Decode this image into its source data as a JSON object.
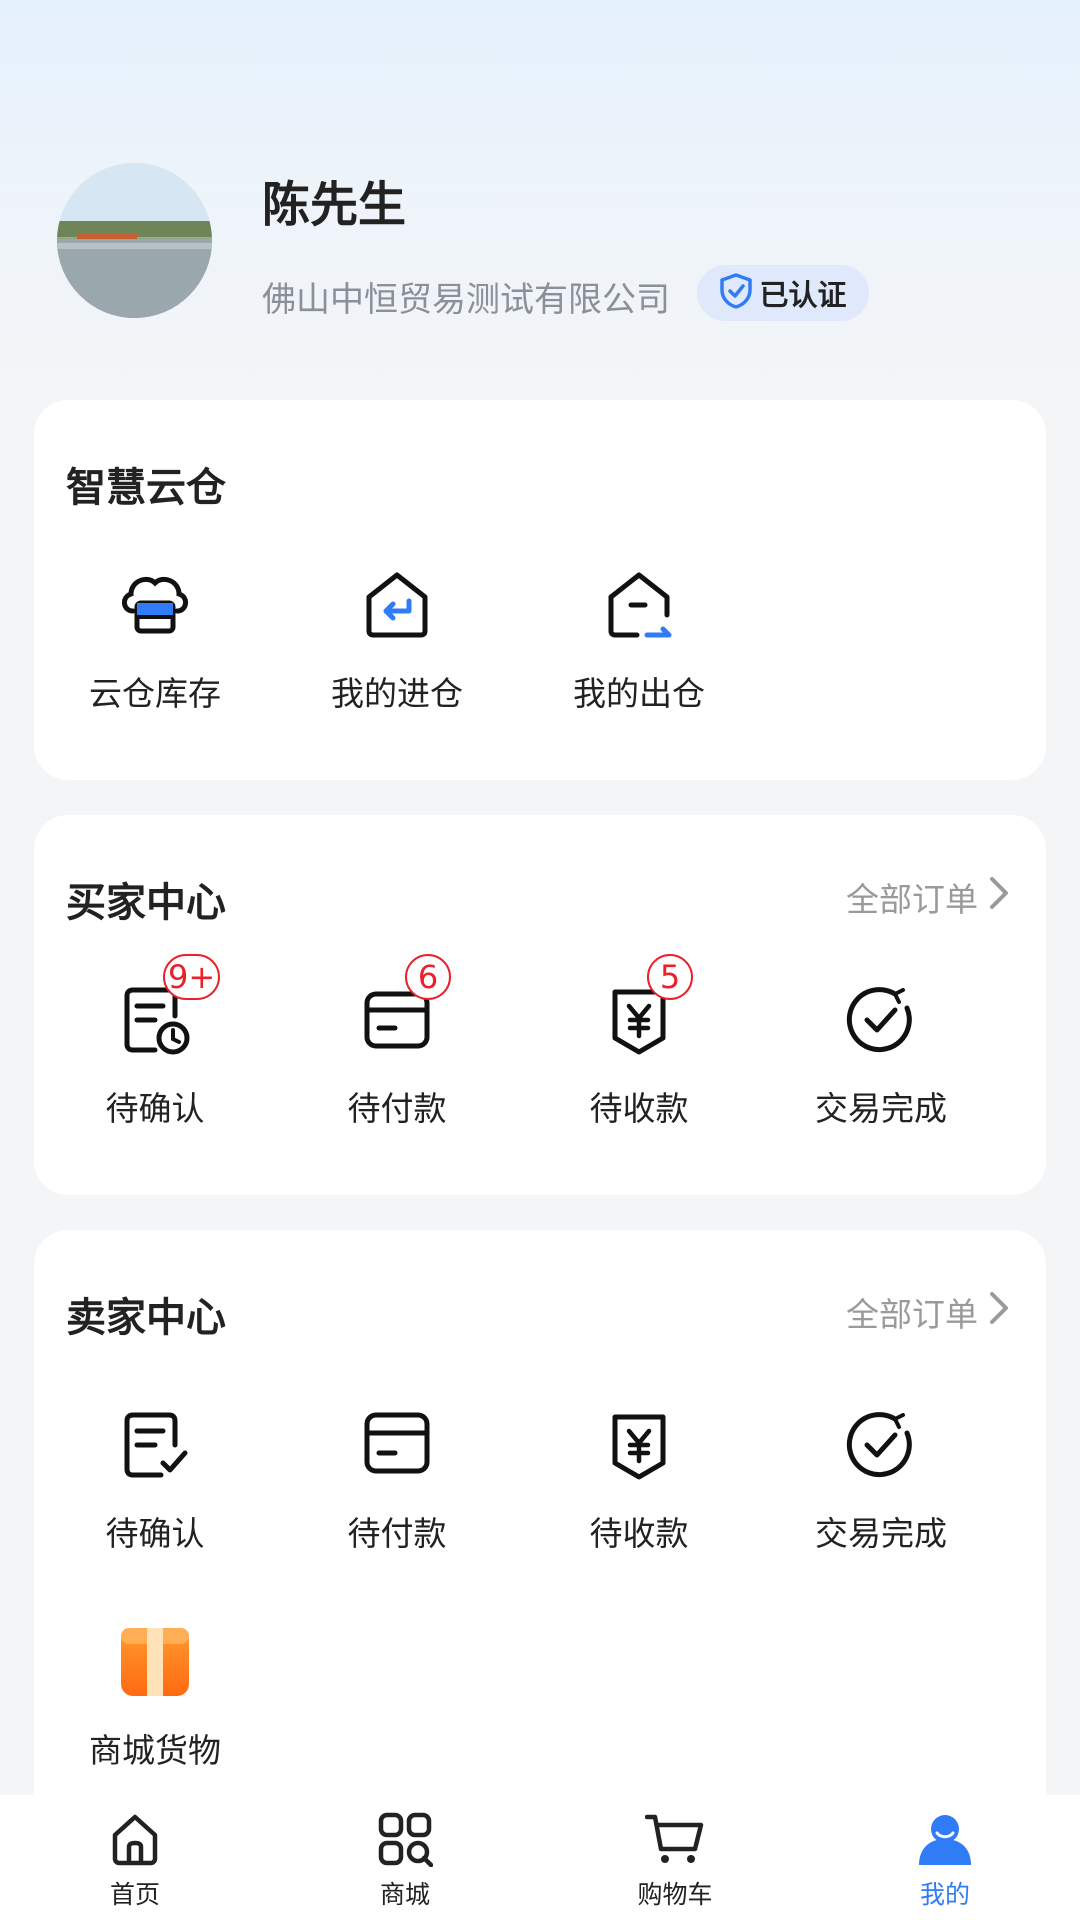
{
  "profile": {
    "name": "陈先生",
    "company": "佛山中恒贸易测试有限公司",
    "verified_label": "已认证"
  },
  "cloud_warehouse": {
    "title": "智慧云仓",
    "items": [
      {
        "label": "云仓库存",
        "icon": "cloud-storage-icon"
      },
      {
        "label": "我的进仓",
        "icon": "inbound-icon"
      },
      {
        "label": "我的出仓",
        "icon": "outbound-icon"
      }
    ]
  },
  "buyer_center": {
    "title": "买家中心",
    "all_orders": "全部订单",
    "items": [
      {
        "label": "待确认",
        "badge": "9+",
        "icon": "pending-confirm-icon"
      },
      {
        "label": "待付款",
        "badge": "6",
        "icon": "pending-payment-icon"
      },
      {
        "label": "待收款",
        "badge": "5",
        "icon": "pending-receipt-icon"
      },
      {
        "label": "交易完成",
        "icon": "trade-complete-icon"
      }
    ]
  },
  "seller_center": {
    "title": "卖家中心",
    "all_orders": "全部订单",
    "items": [
      {
        "label": "待确认",
        "icon": "pending-confirm-icon"
      },
      {
        "label": "待付款",
        "icon": "pending-payment-icon"
      },
      {
        "label": "待收款",
        "icon": "pending-receipt-icon"
      },
      {
        "label": "交易完成",
        "icon": "trade-complete-icon"
      },
      {
        "label": "商城货物",
        "icon": "mall-goods-icon"
      }
    ]
  },
  "tabbar": {
    "active": "我的",
    "items": [
      {
        "label": "首页",
        "icon": "home-icon"
      },
      {
        "label": "商城",
        "icon": "mall-grid-icon"
      },
      {
        "label": "购物车",
        "icon": "cart-icon"
      },
      {
        "label": "我的",
        "icon": "user-icon"
      }
    ]
  },
  "colors": {
    "accent": "#2f7cf6",
    "badge": "#e8212b",
    "muted_text": "#8a8f99"
  }
}
